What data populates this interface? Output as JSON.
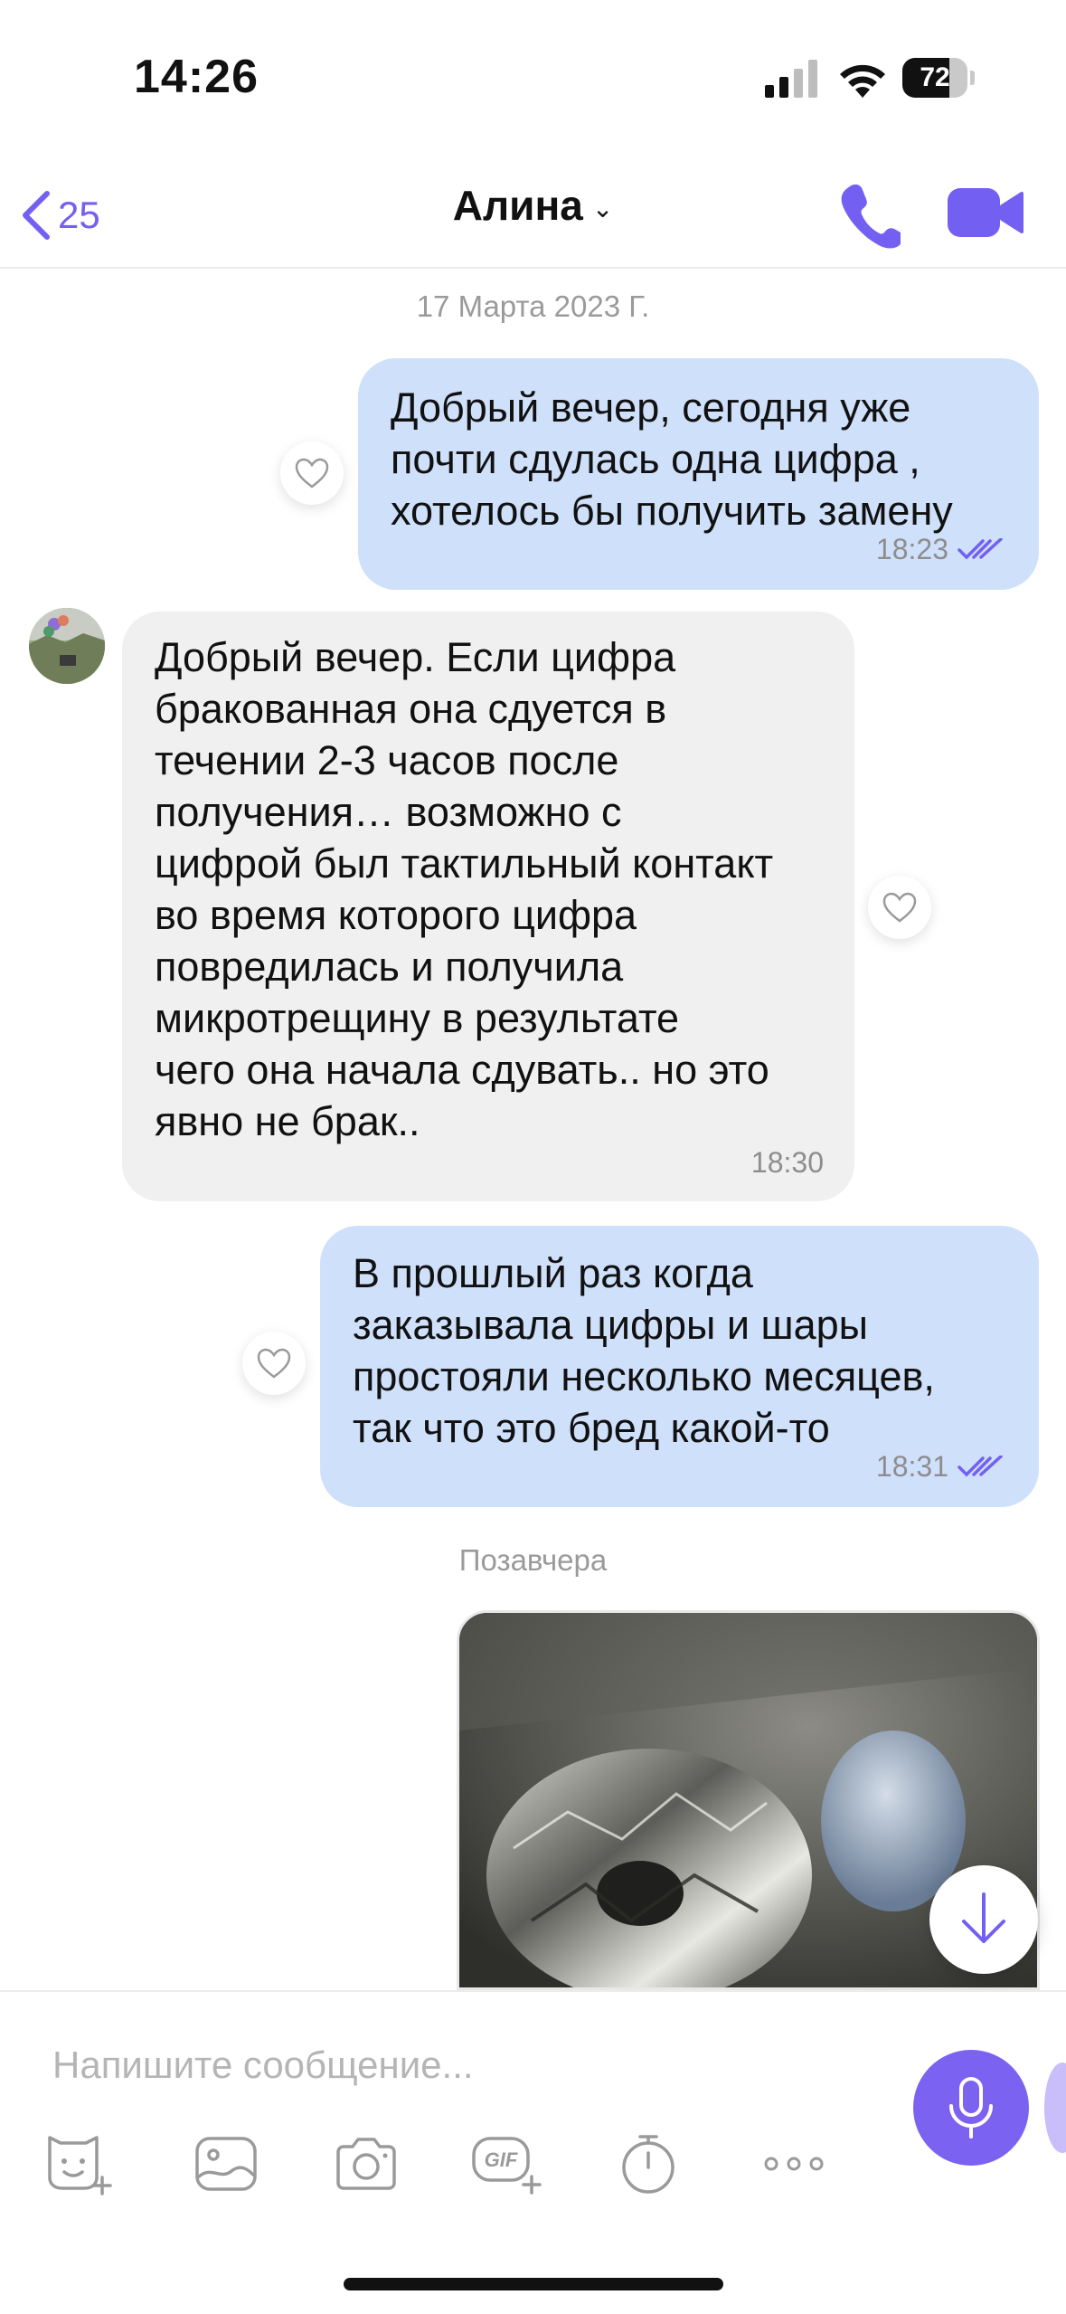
{
  "status_bar": {
    "time": "14:26",
    "battery": "72",
    "battery_level": 0.72
  },
  "header": {
    "back_count": "25",
    "title": "Алина"
  },
  "colors": {
    "accent": "#7360f2",
    "outgoing_bubble": "#cfe0fb",
    "incoming_bubble": "#f0f0f0"
  },
  "chat": {
    "date_1": "17 Марта 2023 Г.",
    "messages": [
      {
        "direction": "out",
        "text": "Добрый вечер, сегодня уже\nпочти сдулась одна цифра ,\nхотелось бы получить замену",
        "time": "18:23"
      },
      {
        "direction": "in",
        "text": "Добрый вечер. Если цифра\nбракованная она сдуется в\nтечении 2-3 часов после\nполучения… возможно с\nцифрой был тактильный контакт\nво время которого цифра\nповредилась и получила\nмикротрещину в результате\nчего она начала сдувать.. но это\nявно не брак..",
        "time": "18:30"
      },
      {
        "direction": "out",
        "text": "В прошлый раз когда\nзаказывала цифры и шары\nпростояли несколько месяцев,\nтак что это бред какой-то",
        "time": "18:31"
      }
    ],
    "date_2": "Позавчера"
  },
  "composer": {
    "placeholder": "Напишите сообщение..."
  },
  "icons": {
    "back": "chevron-left-icon",
    "call": "phone-icon",
    "video": "video-camera-icon",
    "like": "heart-icon",
    "read": "double-check-icon",
    "scroll": "arrow-down-icon",
    "mic": "microphone-icon",
    "sticker": "sticker-icon",
    "gallery": "gallery-icon",
    "camera": "camera-icon",
    "gif": "gif-icon",
    "timer": "timer-icon",
    "more": "more-icon"
  }
}
